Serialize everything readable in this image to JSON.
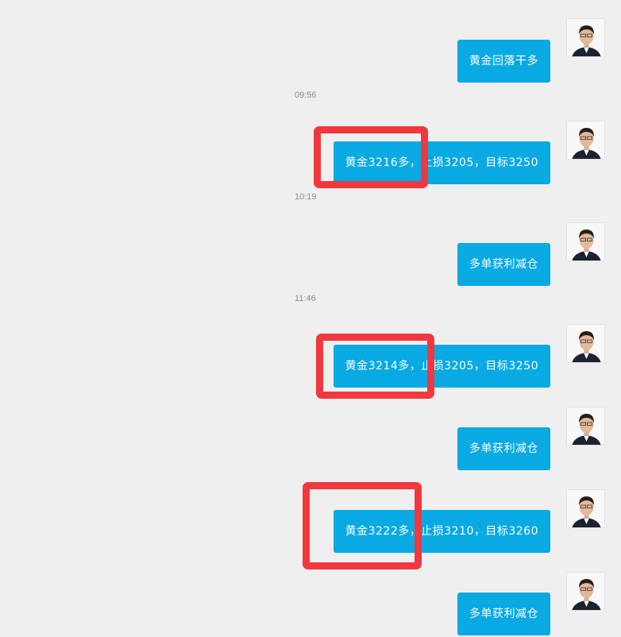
{
  "messages": [
    {
      "text": "黄金回落干多"
    },
    {
      "text": "黄金3216多，止损3205，目标3250"
    },
    {
      "text": "多单获利减仓"
    },
    {
      "text": "黄金3214多，止损3205，目标3250"
    },
    {
      "text": "多单获利减仓"
    },
    {
      "text": "黄金3222多，止损3210，目标3260"
    },
    {
      "text": "多单获利减仓"
    }
  ],
  "timestamps": [
    "09:56",
    "10:19",
    "11:46"
  ],
  "colors": {
    "background": "#efefef",
    "bubble": "#09a9e4",
    "bubble_text": "#ffffff",
    "timestamp": "#8d8d8d",
    "highlight": "#f0383e"
  },
  "icons": {
    "avatar": "user-avatar-photo"
  }
}
